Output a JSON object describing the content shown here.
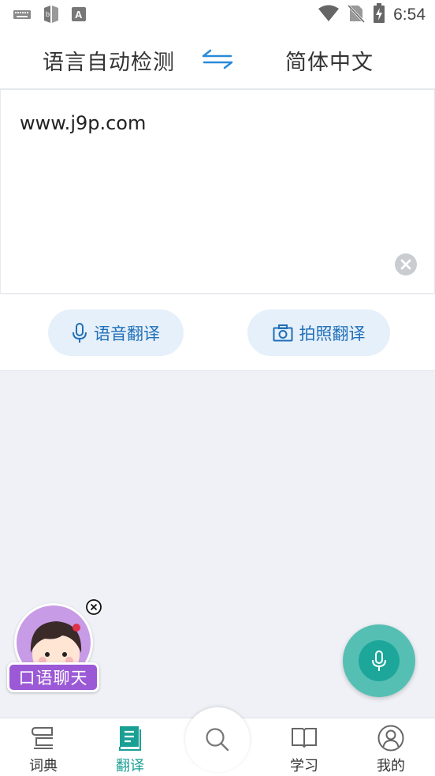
{
  "status_bar": {
    "time": "6:54",
    "left_icons": [
      "keyboard-icon",
      "book-app-icon",
      "font-a-icon"
    ],
    "right_icons": [
      "wifi-icon",
      "no-sim-icon",
      "battery-charging-icon"
    ]
  },
  "language_bar": {
    "source_language": "语言自动检测",
    "target_language": "简体中文",
    "swap_icon": "swap-arrows-icon",
    "accent_color": "#2a8ad8"
  },
  "input": {
    "text": "www.j9p.com"
  },
  "actions": {
    "voice_translate_label": "语音翻译",
    "photo_translate_label": "拍照翻译"
  },
  "chat_promo": {
    "label": "口语聊天",
    "color": "#9b59d6"
  },
  "fab": {
    "icon": "microphone-icon",
    "color": "#1da79b"
  },
  "tabbar": {
    "tabs": [
      {
        "label": "词典",
        "icon": "dictionary-icon",
        "active": false
      },
      {
        "label": "翻译",
        "icon": "translate-icon",
        "active": true
      },
      {
        "label": "学习",
        "icon": "open-book-icon",
        "active": false
      },
      {
        "label": "我的",
        "icon": "user-icon",
        "active": false
      }
    ],
    "center_icon": "search-icon",
    "active_color": "#1a9f94"
  }
}
